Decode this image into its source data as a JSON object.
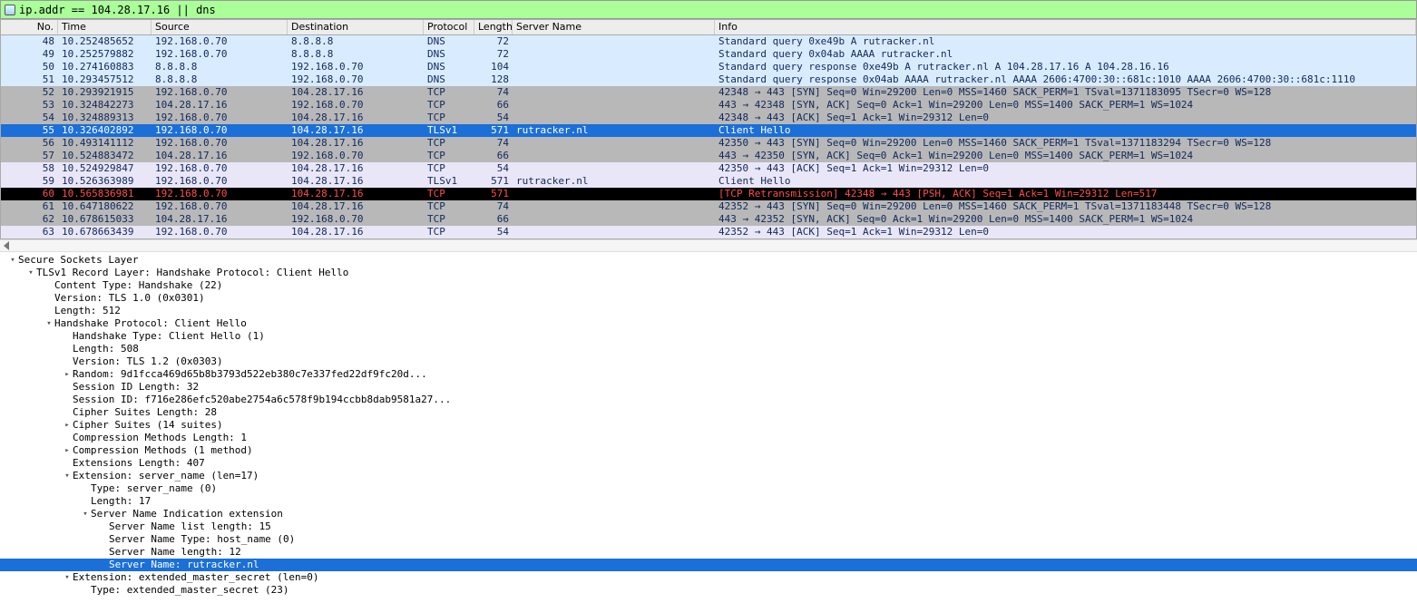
{
  "filter": {
    "text": "ip.addr == 104.28.17.16 || dns"
  },
  "columns": {
    "no": "No.",
    "time": "Time",
    "source": "Source",
    "destination": "Destination",
    "protocol": "Protocol",
    "length": "Length",
    "server_name": "Server Name",
    "info": "Info"
  },
  "packets": [
    {
      "no": "48",
      "time": "10.252485652",
      "src": "192.168.0.70",
      "dst": "8.8.8.8",
      "proto": "DNS",
      "len": "72",
      "sname": "",
      "info": "Standard query 0xe49b A rutracker.nl",
      "row": "dns"
    },
    {
      "no": "49",
      "time": "10.252579882",
      "src": "192.168.0.70",
      "dst": "8.8.8.8",
      "proto": "DNS",
      "len": "72",
      "sname": "",
      "info": "Standard query 0x04ab AAAA rutracker.nl",
      "row": "dns"
    },
    {
      "no": "50",
      "time": "10.274160883",
      "src": "8.8.8.8",
      "dst": "192.168.0.70",
      "proto": "DNS",
      "len": "104",
      "sname": "",
      "info": "Standard query response 0xe49b A rutracker.nl A 104.28.17.16 A 104.28.16.16",
      "row": "dns"
    },
    {
      "no": "51",
      "time": "10.293457512",
      "src": "8.8.8.8",
      "dst": "192.168.0.70",
      "proto": "DNS",
      "len": "128",
      "sname": "",
      "info": "Standard query response 0x04ab AAAA rutracker.nl AAAA 2606:4700:30::681c:1010 AAAA 2606:4700:30::681c:1110",
      "row": "dns"
    },
    {
      "no": "52",
      "time": "10.293921915",
      "src": "192.168.0.70",
      "dst": "104.28.17.16",
      "proto": "TCP",
      "len": "74",
      "sname": "",
      "info": "42348 → 443 [SYN] Seq=0 Win=29200 Len=0 MSS=1460 SACK_PERM=1 TSval=1371183095 TSecr=0 WS=128",
      "row": "tcp"
    },
    {
      "no": "53",
      "time": "10.324842273",
      "src": "104.28.17.16",
      "dst": "192.168.0.70",
      "proto": "TCP",
      "len": "66",
      "sname": "",
      "info": "443 → 42348 [SYN, ACK] Seq=0 Ack=1 Win=29200 Len=0 MSS=1400 SACK_PERM=1 WS=1024",
      "row": "tcp"
    },
    {
      "no": "54",
      "time": "10.324889313",
      "src": "192.168.0.70",
      "dst": "104.28.17.16",
      "proto": "TCP",
      "len": "54",
      "sname": "",
      "info": "42348 → 443 [ACK] Seq=1 Ack=1 Win=29312 Len=0",
      "row": "tcp"
    },
    {
      "no": "55",
      "time": "10.326402892",
      "src": "192.168.0.70",
      "dst": "104.28.17.16",
      "proto": "TLSv1",
      "len": "571",
      "sname": "rutracker.nl",
      "info": "Client Hello",
      "row": "selected"
    },
    {
      "no": "56",
      "time": "10.493141112",
      "src": "192.168.0.70",
      "dst": "104.28.17.16",
      "proto": "TCP",
      "len": "74",
      "sname": "",
      "info": "42350 → 443 [SYN] Seq=0 Win=29200 Len=0 MSS=1460 SACK_PERM=1 TSval=1371183294 TSecr=0 WS=128",
      "row": "tcp"
    },
    {
      "no": "57",
      "time": "10.524883472",
      "src": "104.28.17.16",
      "dst": "192.168.0.70",
      "proto": "TCP",
      "len": "66",
      "sname": "",
      "info": "443 → 42350 [SYN, ACK] Seq=0 Ack=1 Win=29200 Len=0 MSS=1400 SACK_PERM=1 WS=1024",
      "row": "tcp"
    },
    {
      "no": "58",
      "time": "10.524929847",
      "src": "192.168.0.70",
      "dst": "104.28.17.16",
      "proto": "TCP",
      "len": "54",
      "sname": "",
      "info": "42350 → 443 [ACK] Seq=1 Ack=1 Win=29312 Len=0",
      "row": "tcp2"
    },
    {
      "no": "59",
      "time": "10.526363989",
      "src": "192.168.0.70",
      "dst": "104.28.17.16",
      "proto": "TLSv1",
      "len": "571",
      "sname": "rutracker.nl",
      "info": "Client Hello",
      "row": "tcp2"
    },
    {
      "no": "60",
      "time": "10.565836981",
      "src": "192.168.0.70",
      "dst": "104.28.17.16",
      "proto": "TCP",
      "len": "571",
      "sname": "",
      "info": "[TCP Retransmission] 42348 → 443 [PSH, ACK] Seq=1 Ack=1 Win=29312 Len=517",
      "row": "retrans"
    },
    {
      "no": "61",
      "time": "10.647180622",
      "src": "192.168.0.70",
      "dst": "104.28.17.16",
      "proto": "TCP",
      "len": "74",
      "sname": "",
      "info": "42352 → 443 [SYN] Seq=0 Win=29200 Len=0 MSS=1460 SACK_PERM=1 TSval=1371183448 TSecr=0 WS=128",
      "row": "tcp"
    },
    {
      "no": "62",
      "time": "10.678615033",
      "src": "104.28.17.16",
      "dst": "192.168.0.70",
      "proto": "TCP",
      "len": "66",
      "sname": "",
      "info": "443 → 42352 [SYN, ACK] Seq=0 Ack=1 Win=29200 Len=0 MSS=1400 SACK_PERM=1 WS=1024",
      "row": "tcp"
    },
    {
      "no": "63",
      "time": "10.678663439",
      "src": "192.168.0.70",
      "dst": "104.28.17.16",
      "proto": "TCP",
      "len": "54",
      "sname": "",
      "info": "42352 → 443 [ACK] Seq=1 Ack=1 Win=29312 Len=0",
      "row": "tcp2"
    }
  ],
  "row_colors": {
    "dns": {
      "bg": "#d9ecff",
      "fg": "#10285a"
    },
    "tcp": {
      "bg": "#b8b8b8",
      "fg": "#10285a"
    },
    "tcp2": {
      "bg": "#e9e6f7",
      "fg": "#10285a"
    },
    "selected": {
      "bg": "#1a6fd9",
      "fg": "#ffffff"
    },
    "retrans": {
      "bg": "#000000",
      "fg": "#ff4d4d"
    }
  },
  "tree": [
    {
      "indent": 0,
      "toggle": "▾",
      "text": "Secure Sockets Layer",
      "sel": false
    },
    {
      "indent": 1,
      "toggle": "▾",
      "text": "TLSv1 Record Layer: Handshake Protocol: Client Hello",
      "sel": false
    },
    {
      "indent": 2,
      "toggle": "",
      "text": "Content Type: Handshake (22)",
      "sel": false
    },
    {
      "indent": 2,
      "toggle": "",
      "text": "Version: TLS 1.0 (0x0301)",
      "sel": false
    },
    {
      "indent": 2,
      "toggle": "",
      "text": "Length: 512",
      "sel": false
    },
    {
      "indent": 2,
      "toggle": "▾",
      "text": "Handshake Protocol: Client Hello",
      "sel": false
    },
    {
      "indent": 3,
      "toggle": "",
      "text": "Handshake Type: Client Hello (1)",
      "sel": false
    },
    {
      "indent": 3,
      "toggle": "",
      "text": "Length: 508",
      "sel": false
    },
    {
      "indent": 3,
      "toggle": "",
      "text": "Version: TLS 1.2 (0x0303)",
      "sel": false
    },
    {
      "indent": 3,
      "toggle": "▸",
      "text": "Random: 9d1fcca469d65b8b3793d522eb380c7e337fed22df9fc20d...",
      "sel": false
    },
    {
      "indent": 3,
      "toggle": "",
      "text": "Session ID Length: 32",
      "sel": false
    },
    {
      "indent": 3,
      "toggle": "",
      "text": "Session ID: f716e286efc520abe2754a6c578f9b194ccbb8dab9581a27...",
      "sel": false
    },
    {
      "indent": 3,
      "toggle": "",
      "text": "Cipher Suites Length: 28",
      "sel": false
    },
    {
      "indent": 3,
      "toggle": "▸",
      "text": "Cipher Suites (14 suites)",
      "sel": false
    },
    {
      "indent": 3,
      "toggle": "",
      "text": "Compression Methods Length: 1",
      "sel": false
    },
    {
      "indent": 3,
      "toggle": "▸",
      "text": "Compression Methods (1 method)",
      "sel": false
    },
    {
      "indent": 3,
      "toggle": "",
      "text": "Extensions Length: 407",
      "sel": false
    },
    {
      "indent": 3,
      "toggle": "▾",
      "text": "Extension: server_name (len=17)",
      "sel": false
    },
    {
      "indent": 4,
      "toggle": "",
      "text": "Type: server_name (0)",
      "sel": false
    },
    {
      "indent": 4,
      "toggle": "",
      "text": "Length: 17",
      "sel": false
    },
    {
      "indent": 4,
      "toggle": "▾",
      "text": "Server Name Indication extension",
      "sel": false
    },
    {
      "indent": 5,
      "toggle": "",
      "text": "Server Name list length: 15",
      "sel": false
    },
    {
      "indent": 5,
      "toggle": "",
      "text": "Server Name Type: host_name (0)",
      "sel": false
    },
    {
      "indent": 5,
      "toggle": "",
      "text": "Server Name length: 12",
      "sel": false
    },
    {
      "indent": 5,
      "toggle": "",
      "text": "Server Name: rutracker.nl",
      "sel": true
    },
    {
      "indent": 3,
      "toggle": "▾",
      "text": "Extension: extended_master_secret (len=0)",
      "sel": false
    },
    {
      "indent": 4,
      "toggle": "",
      "text": "Type: extended_master_secret (23)",
      "sel": false
    }
  ]
}
